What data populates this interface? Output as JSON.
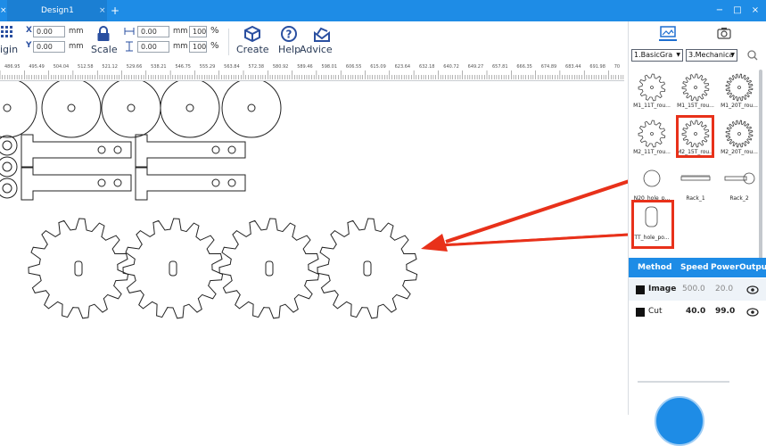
{
  "titlebar": {
    "left_close": "×",
    "tab_title": "Design1",
    "tab_close": "×",
    "tab_add": "+",
    "minimize": "−",
    "maximize": "□",
    "close": "×",
    "color": "#1e8ce6"
  },
  "toolbar": {
    "origin_label": "igin",
    "x_label": "X",
    "y_label": "Y",
    "x_value": "0.00",
    "y_value": "0.00",
    "x_unit": "mm",
    "y_unit": "mm",
    "scale_label": "Scale",
    "width_value": "0.00",
    "height_value": "0.00",
    "width_unit": "mm",
    "height_unit": "mm",
    "width_pct": "100",
    "height_pct": "100",
    "pct_sign_w": "%",
    "pct_sign_h": "%",
    "create_label": "Create",
    "help_label": "Help",
    "advice_label": "Advice"
  },
  "ruler": {
    "labels": [
      "486.95",
      "495.49",
      "504.04",
      "512.58",
      "521.12",
      "529.66",
      "538.21",
      "546.75",
      "555.29",
      "563.84",
      "572.38",
      "580.92",
      "589.46",
      "598.01",
      "606.55",
      "615.09",
      "623.64",
      "632.18",
      "640.72",
      "649.27",
      "657.81",
      "666.35",
      "674.89",
      "683.44",
      "691.98",
      "70"
    ]
  },
  "panel": {
    "tab_library_icon": "image-library-icon",
    "tab_camera_icon": "camera-icon",
    "category_select": "1.BasicGra",
    "subcategory_select": "3.Mechanica",
    "library_items": [
      {
        "label": "M1_11T_rou..."
      },
      {
        "label": "M1_15T_rou..."
      },
      {
        "label": "M1_20T_rou..."
      },
      {
        "label": "M2_11T_rou..."
      },
      {
        "label": "M2_15T_rou..."
      },
      {
        "label": "M2_20T_rou..."
      },
      {
        "label": "N20_hole_p..."
      },
      {
        "label": "Rack_1"
      },
      {
        "label": "Rack_2"
      },
      {
        "label": "TT_hole_po..."
      }
    ],
    "highlight_color": "#e8311a"
  },
  "layers": {
    "headers": {
      "method": "Method",
      "speed": "Speed",
      "power": "Power",
      "output": "Output"
    },
    "rows": [
      {
        "method": "Image",
        "speed": "500.0",
        "power": "20.0"
      },
      {
        "method": "Cut",
        "speed": "40.0",
        "power": "99.0"
      }
    ]
  }
}
